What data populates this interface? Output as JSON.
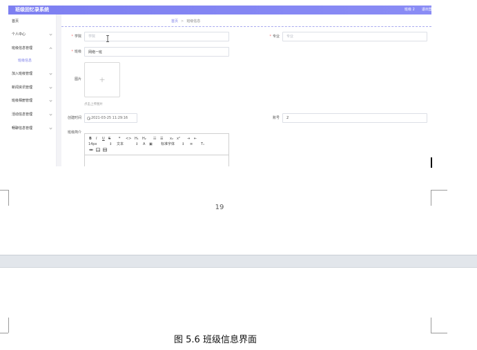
{
  "app": {
    "title": "班级回忆录系统",
    "user_label": "班级 2",
    "logout_label": "退出登"
  },
  "sidebar": {
    "items": [
      {
        "label": "首页"
      },
      {
        "label": "个人中心"
      },
      {
        "label": "班级信息管理",
        "children": [
          {
            "label": "班级信息"
          }
        ]
      },
      {
        "label": "加入班级管理"
      },
      {
        "label": "新闻资讯管理"
      },
      {
        "label": "班级相册管理"
      },
      {
        "label": "活动信息管理"
      },
      {
        "label": "畅聊信息管理"
      }
    ]
  },
  "breadcrumb": {
    "home": "首页",
    "separator": ">",
    "current": "班级信息"
  },
  "form": {
    "college": {
      "required": "*",
      "label": "学院",
      "placeholder": "学院"
    },
    "major": {
      "required": "*",
      "label": "专业",
      "placeholder": "专业"
    },
    "class_name": {
      "required": "*",
      "label": "班级",
      "value": "网络一班"
    },
    "image": {
      "label": "图片",
      "upload_symbol": "+",
      "hint": "点击上传图片"
    },
    "created_at": {
      "label": "创建时间",
      "icon": "clock-icon",
      "value": "2021-03-25 11:29:16"
    },
    "account": {
      "label": "账号",
      "value": "2"
    },
    "intro": {
      "label": "班级简介"
    }
  },
  "editor": {
    "toolbar": {
      "row1": [
        {
          "icon": "bold-icon",
          "glyph": "B"
        },
        {
          "icon": "italic-icon",
          "glyph": "I"
        },
        {
          "icon": "underline-icon",
          "glyph": "U"
        },
        {
          "icon": "strikethrough-icon",
          "glyph": "S"
        },
        {
          "icon": "blockquote-icon",
          "glyph": "❞"
        },
        {
          "icon": "code-block-icon",
          "glyph": "<>"
        },
        {
          "icon": "heading-1-icon",
          "glyph": "H₁"
        },
        {
          "icon": "heading-2-icon",
          "glyph": "H₂"
        },
        {
          "icon": "ordered-list-icon",
          "glyph": "☷"
        },
        {
          "icon": "bullet-list-icon",
          "glyph": "☰"
        },
        {
          "icon": "subscript-icon",
          "glyph": "x₂"
        },
        {
          "icon": "superscript-icon",
          "glyph": "x²"
        },
        {
          "icon": "indent-icon",
          "glyph": "⇥"
        },
        {
          "icon": "outdent-icon",
          "glyph": "⇤"
        }
      ],
      "row2": [
        {
          "icon": "font-size-select",
          "glyph": "14px"
        },
        {
          "icon": "dropdown-arrow-icon",
          "glyph": "↕"
        },
        {
          "icon": "text-style-select",
          "glyph": "文本"
        },
        {
          "icon": "dropdown-arrow-icon",
          "glyph": "↕"
        },
        {
          "icon": "font-color-icon",
          "glyph": "A"
        },
        {
          "icon": "background-color-icon",
          "glyph": "▣"
        },
        {
          "icon": "font-family-select",
          "glyph": "标准字体"
        },
        {
          "icon": "dropdown-arrow-icon",
          "glyph": "↕"
        },
        {
          "icon": "align-icon",
          "glyph": "≡"
        },
        {
          "icon": "clear-format-icon",
          "glyph": "Tₓ"
        }
      ],
      "row3": [
        {
          "icon": "link-icon"
        },
        {
          "icon": "image-icon"
        },
        {
          "icon": "video-icon"
        }
      ]
    }
  },
  "document": {
    "page_number": "19",
    "caption": "图 5.6 班级信息界面"
  },
  "colors": {
    "header": "#7d7ff1",
    "accent": "#7b7de8",
    "required": "#f56c6c",
    "page_gap": "#e2e6eb"
  }
}
